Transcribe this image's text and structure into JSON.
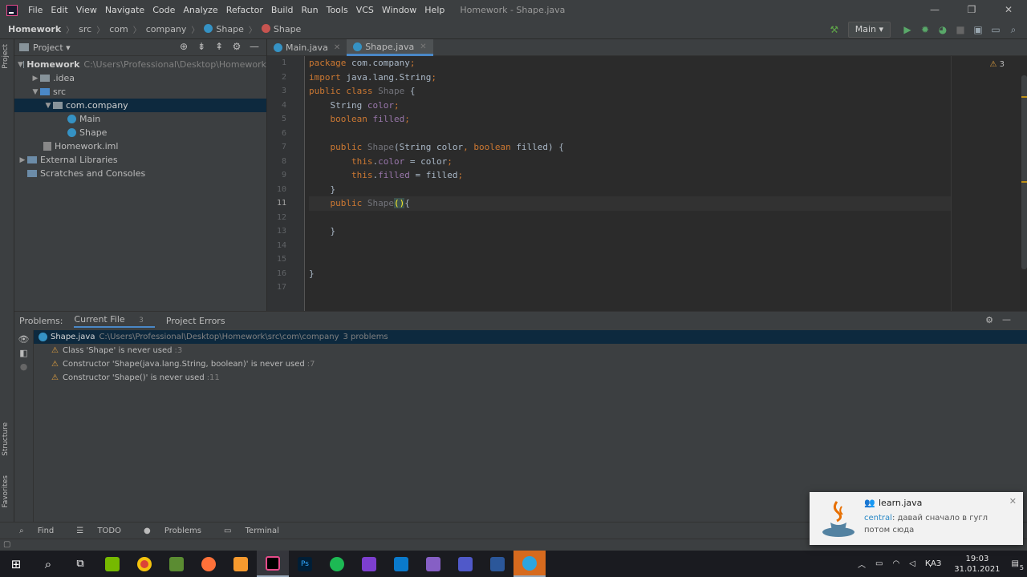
{
  "menu": [
    "File",
    "Edit",
    "View",
    "Navigate",
    "Code",
    "Analyze",
    "Refactor",
    "Build",
    "Run",
    "Tools",
    "VCS",
    "Window",
    "Help"
  ],
  "window_title": "Homework - Shape.java",
  "win_controls": {
    "minimize": "—",
    "maximize": "❐",
    "close": "✕"
  },
  "breadcrumb": [
    "Homework",
    "src",
    "com",
    "company",
    "Shape",
    "Shape"
  ],
  "run_config": "Main ▾",
  "project": {
    "header": "Project ▾",
    "tree": [
      {
        "label": "Homework",
        "path": "C:\\Users\\Professional\\Desktop\\Homework"
      },
      {
        "label": ".idea"
      },
      {
        "label": "src"
      },
      {
        "label": "com.company"
      },
      {
        "label": "Main"
      },
      {
        "label": "Shape"
      },
      {
        "label": "Homework.iml"
      },
      {
        "label": "External Libraries"
      },
      {
        "label": "Scratches and Consoles"
      }
    ]
  },
  "tabs": [
    {
      "label": "Main.java"
    },
    {
      "label": "Shape.java"
    }
  ],
  "warnings_badge": "3",
  "line_numbers": [
    "1",
    "2",
    "3",
    "4",
    "5",
    "6",
    "7",
    "8",
    "9",
    "10",
    "11",
    "12",
    "13",
    "14",
    "15",
    "16",
    "17"
  ],
  "current_line": 11,
  "problems": {
    "tab_label": "Problems:",
    "tabs": [
      "Current File",
      "Project Errors"
    ],
    "current_file_count": "3",
    "file": {
      "name": "Shape.java",
      "path": "C:\\Users\\Professional\\Desktop\\Homework\\src\\com\\company",
      "count": "3 problems"
    },
    "items": [
      {
        "text": "Class 'Shape' is never used",
        "line": ":3"
      },
      {
        "text": "Constructor 'Shape(java.lang.String, boolean)' is never used",
        "line": ":7"
      },
      {
        "text": "Constructor 'Shape()' is never used",
        "line": ":11"
      }
    ]
  },
  "left_strip": {
    "project": "Project",
    "structure": "Structure",
    "favorites": "Favorites"
  },
  "bottom_tools": [
    "Find",
    "TODO",
    "Problems",
    "Terminal"
  ],
  "toast": {
    "group": "learn.java",
    "sender": "central",
    "message": ": давай сначало в гугл потом сюда",
    "close": "✕"
  },
  "tray": {
    "lang": "ҚАЗ",
    "time": "19:03",
    "date": "31.01.2021",
    "notif": "5"
  },
  "colors": {
    "accent": "#4a88c7",
    "keyword": "#cc7832",
    "field": "#9876aa",
    "warning": "#e0a040"
  }
}
